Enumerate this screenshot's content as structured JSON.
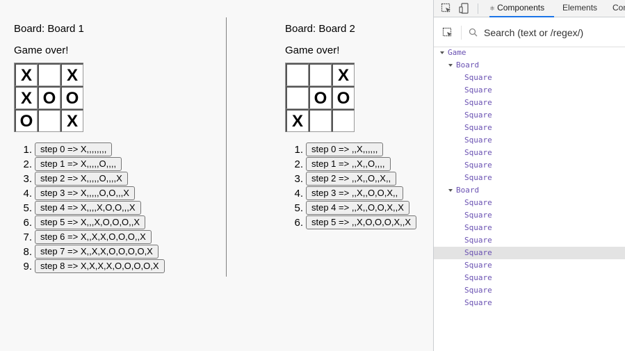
{
  "games": [
    {
      "board_title": "Board: Board 1",
      "status": "Game over!",
      "squares": [
        "X",
        "",
        "X",
        "X",
        "O",
        "O",
        "O",
        "",
        "X"
      ],
      "moves": [
        {
          "num": "1.",
          "label": "step 0 => X,,,,,,,,"
        },
        {
          "num": "2.",
          "label": "step 1 => X,,,,,O,,,,"
        },
        {
          "num": "3.",
          "label": "step 2 => X,,,,,O,,,,X"
        },
        {
          "num": "4.",
          "label": "step 3 => X,,,,,O,O,,,X"
        },
        {
          "num": "5.",
          "label": "step 4 => X,,,,X,O,O,,,X"
        },
        {
          "num": "6.",
          "label": "step 5 => X,,,X,O,O,O,,X"
        },
        {
          "num": "7.",
          "label": "step 6 => X,,X,X,O,O,O,,X"
        },
        {
          "num": "8.",
          "label": "step 7 => X,,X,X,O,O,O,O,X"
        },
        {
          "num": "9.",
          "label": "step 8 => X,X,X,X,O,O,O,O,X"
        }
      ]
    },
    {
      "board_title": "Board: Board 2",
      "status": "Game over!",
      "squares": [
        "",
        "",
        "X",
        "",
        "O",
        "O",
        "X",
        "",
        ""
      ],
      "moves": [
        {
          "num": "1.",
          "label": "step 0 => ,,X,,,,,,"
        },
        {
          "num": "2.",
          "label": "step 1 => ,,X,,O,,,,"
        },
        {
          "num": "3.",
          "label": "step 2 => ,,X,,O,,X,,"
        },
        {
          "num": "4.",
          "label": "step 3 => ,,X,,O,O,X,,"
        },
        {
          "num": "5.",
          "label": "step 4 => ,,X,,O,O,X,,X"
        },
        {
          "num": "6.",
          "label": "step 5 => ,,X,O,O,O,X,,X"
        }
      ]
    }
  ],
  "devtools": {
    "tabs": [
      {
        "label": "Components",
        "icon": "react-icon",
        "active": true
      },
      {
        "label": "Elements",
        "active": false
      },
      {
        "label": "Con",
        "active": false
      }
    ],
    "search_placeholder": "Search (text or /regex/)",
    "tree": [
      {
        "label": "Game",
        "level": 0,
        "expanded": true
      },
      {
        "label": "Board",
        "level": 1,
        "expanded": true
      },
      {
        "label": "Square",
        "level": 2
      },
      {
        "label": "Square",
        "level": 2
      },
      {
        "label": "Square",
        "level": 2
      },
      {
        "label": "Square",
        "level": 2
      },
      {
        "label": "Square",
        "level": 2
      },
      {
        "label": "Square",
        "level": 2
      },
      {
        "label": "Square",
        "level": 2
      },
      {
        "label": "Square",
        "level": 2
      },
      {
        "label": "Square",
        "level": 2
      },
      {
        "label": "Board",
        "level": 1,
        "expanded": true
      },
      {
        "label": "Square",
        "level": 2
      },
      {
        "label": "Square",
        "level": 2
      },
      {
        "label": "Square",
        "level": 2
      },
      {
        "label": "Square",
        "level": 2
      },
      {
        "label": "Square",
        "level": 2,
        "selected": true
      },
      {
        "label": "Square",
        "level": 2
      },
      {
        "label": "Square",
        "level": 2
      },
      {
        "label": "Square",
        "level": 2
      },
      {
        "label": "Square",
        "level": 2
      }
    ]
  },
  "colors": {
    "component_name": "#6a51b2",
    "active_tab_underline": "#1a73e8",
    "selected_row": "#e3e3e3"
  }
}
